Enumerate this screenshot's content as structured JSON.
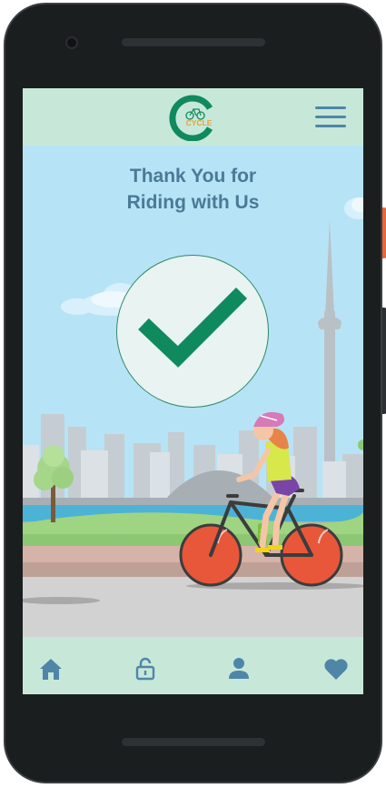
{
  "thank_you": {
    "message": "Thank You for\nRiding with Us",
    "status": "ride-complete"
  },
  "header": {
    "logo_text": "CYCLE",
    "menu_icon": "hamburger-menu-icon"
  },
  "tabbar": {
    "tabs": [
      {
        "icon": "home-icon"
      },
      {
        "icon": "unlock-icon"
      },
      {
        "icon": "profile-icon"
      },
      {
        "icon": "heart-icon"
      }
    ]
  },
  "colors": {
    "accent_green": "#0f8a5f",
    "header_bg": "#c7e8d9",
    "sky": "#b7e3f6",
    "icon_blue": "#4f86a8",
    "bike_wheel": "#e8573a"
  }
}
